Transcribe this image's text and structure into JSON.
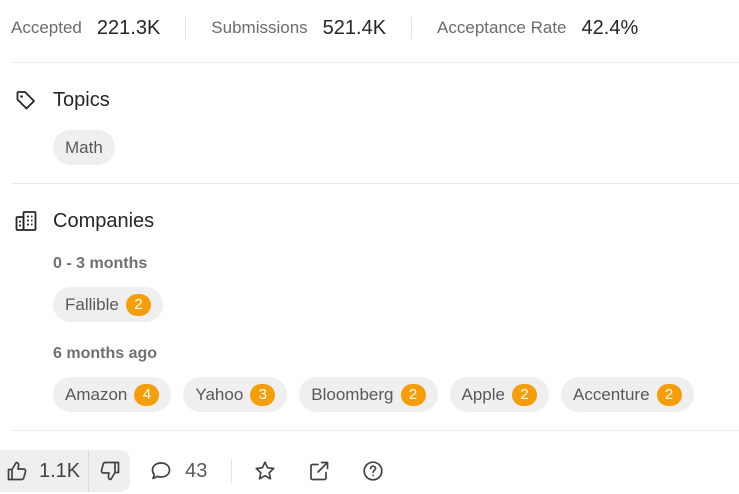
{
  "stats": [
    {
      "label": "Accepted",
      "value": "221.3K"
    },
    {
      "label": "Submissions",
      "value": "521.4K"
    },
    {
      "label": "Acceptance Rate",
      "value": "42.4%"
    }
  ],
  "topics": {
    "title": "Topics",
    "icon": "tag-icon",
    "tags": [
      "Math"
    ]
  },
  "companies": {
    "title": "Companies",
    "icon": "building-icon",
    "groups": [
      {
        "period": "0 - 3 months",
        "items": [
          {
            "name": "Fallible",
            "count": "2"
          }
        ]
      },
      {
        "period": "6 months ago",
        "items": [
          {
            "name": "Amazon",
            "count": "4"
          },
          {
            "name": "Yahoo",
            "count": "3"
          },
          {
            "name": "Bloomberg",
            "count": "2"
          },
          {
            "name": "Apple",
            "count": "2"
          },
          {
            "name": "Accenture",
            "count": "2"
          }
        ]
      }
    ]
  },
  "footer": {
    "likes": "1.1K",
    "comments": "43",
    "icons": [
      "thumbs-up-icon",
      "thumbs-down-icon",
      "comment-icon",
      "star-icon",
      "share-icon",
      "help-icon"
    ]
  },
  "colors": {
    "badge": "#f59e0b",
    "chip_bg": "#efefef",
    "divider": "#ececec"
  }
}
